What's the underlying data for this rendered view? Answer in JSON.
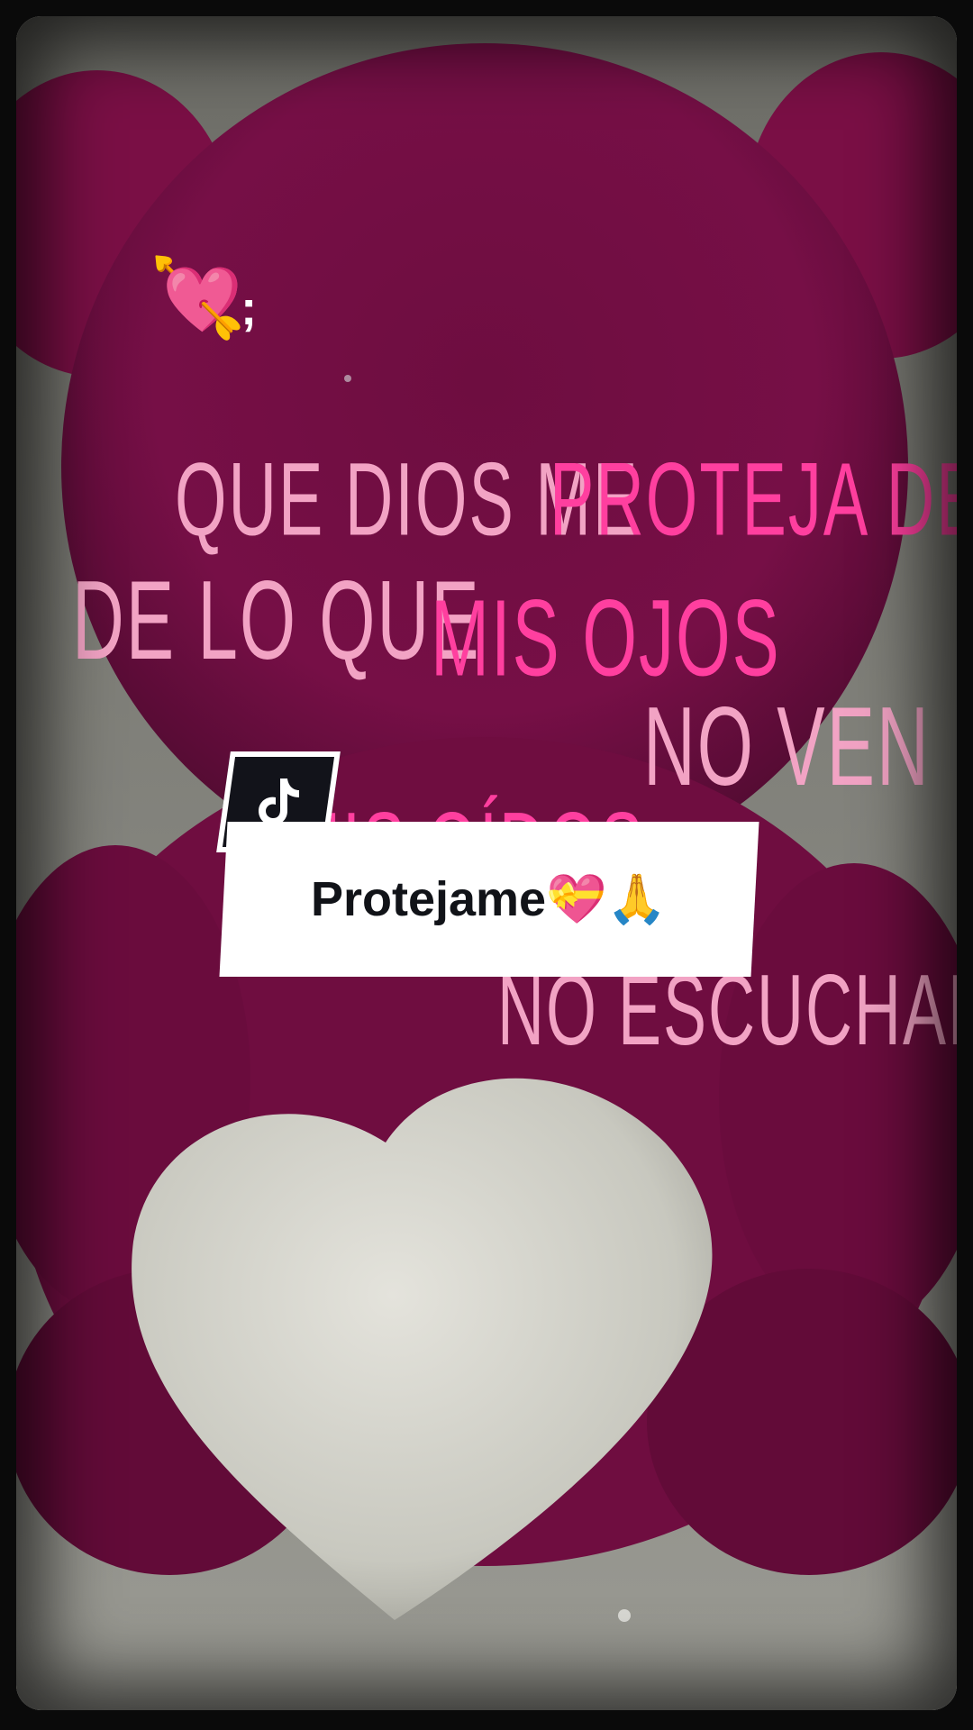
{
  "sticker": {
    "emoji": "💘",
    "suffix": ";"
  },
  "lyrics": {
    "line1a": "QUE DIOS ME",
    "line1b": "PROTEJA DE",
    "line2a": "DE LO QUE",
    "line2b": "MIS OJOS",
    "line3": "NO VEN",
    "line4a": "MIS OÍDOS",
    "line5": "NO ESCUCHAN"
  },
  "caption": {
    "text": "Protejame💝🙏"
  },
  "icons": {
    "brand": "tiktok-icon"
  },
  "colors": {
    "lyric_light": "#f2a3c4",
    "lyric_hot": "#ff3f9f",
    "bear": "#7a0f45",
    "heart": "#d8d8d0",
    "caption_bg": "#ffffff",
    "badge_bg": "#12131a"
  }
}
